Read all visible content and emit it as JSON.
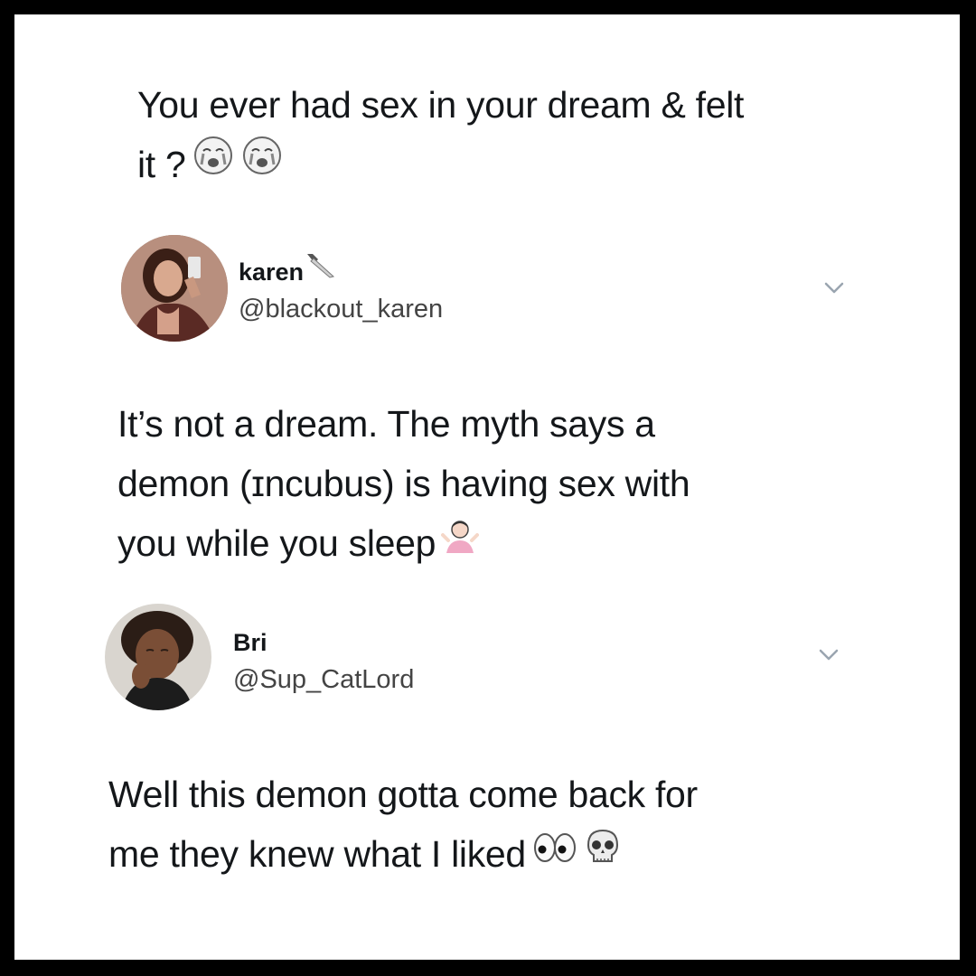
{
  "tweet1": {
    "text": "You ever had sex in your dream & felt\nit ?",
    "emojis": [
      "crying-face-icon",
      "crying-face-icon"
    ]
  },
  "reply1": {
    "display_name": "karen",
    "name_emoji": "knife-icon",
    "handle": "@blackout_karen",
    "text": "It’s not a dream. The myth says a\ndemon (ɪncubus) is having sex with\nyou while you sleep",
    "emojis": [
      "woman-shrugging-icon"
    ]
  },
  "reply2": {
    "display_name": "Bri",
    "handle": "@Sup_CatLord",
    "text": "Well this demon gotta come back for\nme they knew what I liked",
    "emojis": [
      "eyes-icon",
      "skull-icon"
    ]
  },
  "colors": {
    "frame": "#000000",
    "background": "#ffffff",
    "text": "#14171a",
    "handle": "#444444",
    "chevron": "#9aa5b0"
  }
}
